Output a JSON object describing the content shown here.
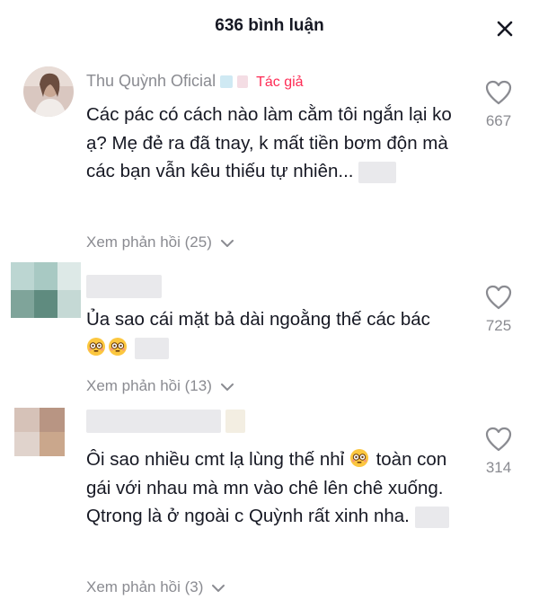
{
  "header": {
    "title": "636 bình luận",
    "close_icon": "close-icon"
  },
  "comments": [
    {
      "username": "Thu Quỳnh Oficial",
      "badge": "Tác giả",
      "text": "Các pác có cách nào làm cằm tôi ngắn lại ko ạ? Mẹ đẻ ra đã tnay, k mất tiền bơm độn mà các bạn vẫn kêu thiếu tự nhiên...",
      "replies": "Xem phản hồi (25)",
      "likes": "667"
    },
    {
      "username": "",
      "text": "Ủa sao cái mặt bả dài ngoằng thế các bác",
      "replies": "Xem phản hồi (13)",
      "likes": "725"
    },
    {
      "username": "",
      "text_line1": "Ôi sao nhiều cmt lạ lùng thế nhỉ",
      "text_rest": "toàn con gái với nhau mà mn vào chê lên chê xuống. Qtrong là ở ngoài c Quỳnh rất xinh nha.",
      "replies": "Xem phản hồi (3)",
      "likes": "314"
    }
  ],
  "colors": {
    "accent": "#fe2c55",
    "secondary_text": "#8a8b91",
    "primary_text": "#161823"
  }
}
